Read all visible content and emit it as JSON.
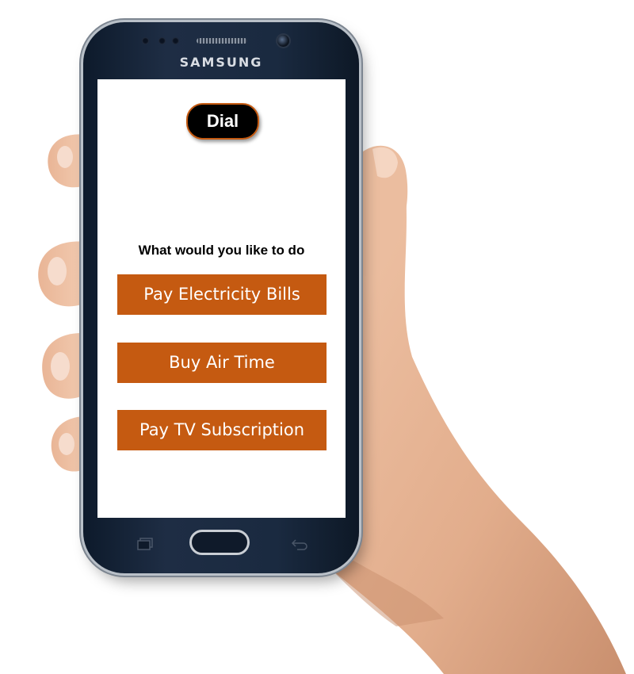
{
  "phone": {
    "brand": "SAMSUNG"
  },
  "screen": {
    "dial_label": "Dial",
    "prompt": "What would you like to do",
    "options": [
      {
        "label": "Pay Electricity Bills"
      },
      {
        "label": "Buy Air Time"
      },
      {
        "label": "Pay TV Subscription"
      }
    ]
  },
  "colors": {
    "accent": "#c55a11",
    "dial_bg": "#000000",
    "phone_body": "#1a2a40",
    "skin": "#e8b99a"
  },
  "icons": {
    "recent_apps": "recent-apps-icon",
    "back": "back-icon",
    "home": "home-button"
  }
}
